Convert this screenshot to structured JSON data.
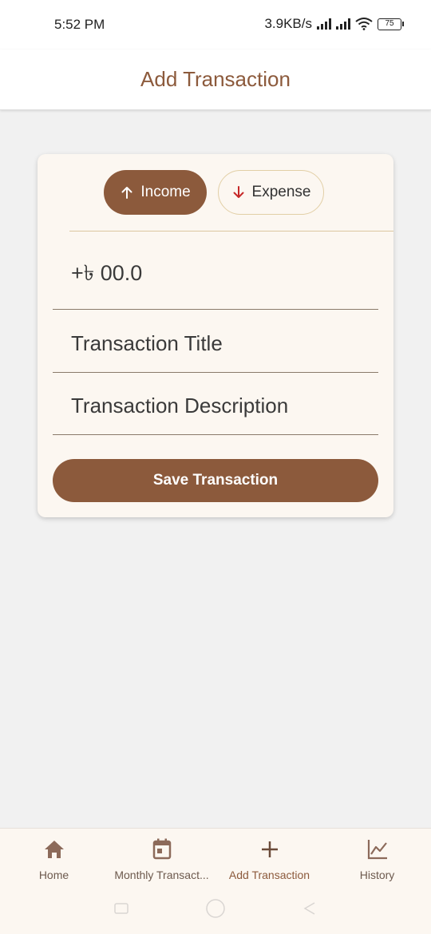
{
  "status_bar": {
    "time": "5:52 PM",
    "network_speed": "3.9KB/s",
    "battery": "75",
    "icons": [
      "signal-icon",
      "signal-icon",
      "wifi-icon",
      "battery-icon"
    ]
  },
  "app_bar": {
    "title": "Add Transaction"
  },
  "form": {
    "type_toggle": {
      "income_label": "Income",
      "income_icon": "arrow-up-icon",
      "expense_label": "Expense",
      "expense_icon": "arrow-down-icon",
      "selected": "Income"
    },
    "amount_placeholder": "+৳ 00.0",
    "title_placeholder": "Transaction Title",
    "description_placeholder": "Transaction Description",
    "save_label": "Save Transaction"
  },
  "bottom_nav": {
    "items": [
      {
        "label": "Home",
        "icon": "home-icon"
      },
      {
        "label": "Monthly Transact...",
        "icon": "calendar-icon"
      },
      {
        "label": "Add Transaction",
        "icon": "plus-icon",
        "active": true
      },
      {
        "label": "History",
        "icon": "chart-line-icon"
      }
    ]
  },
  "colors": {
    "primary": "#8c5a3c",
    "card_background": "#fcf7f1",
    "page_background": "#f1f1f1",
    "expense_arrow": "#c62828"
  }
}
